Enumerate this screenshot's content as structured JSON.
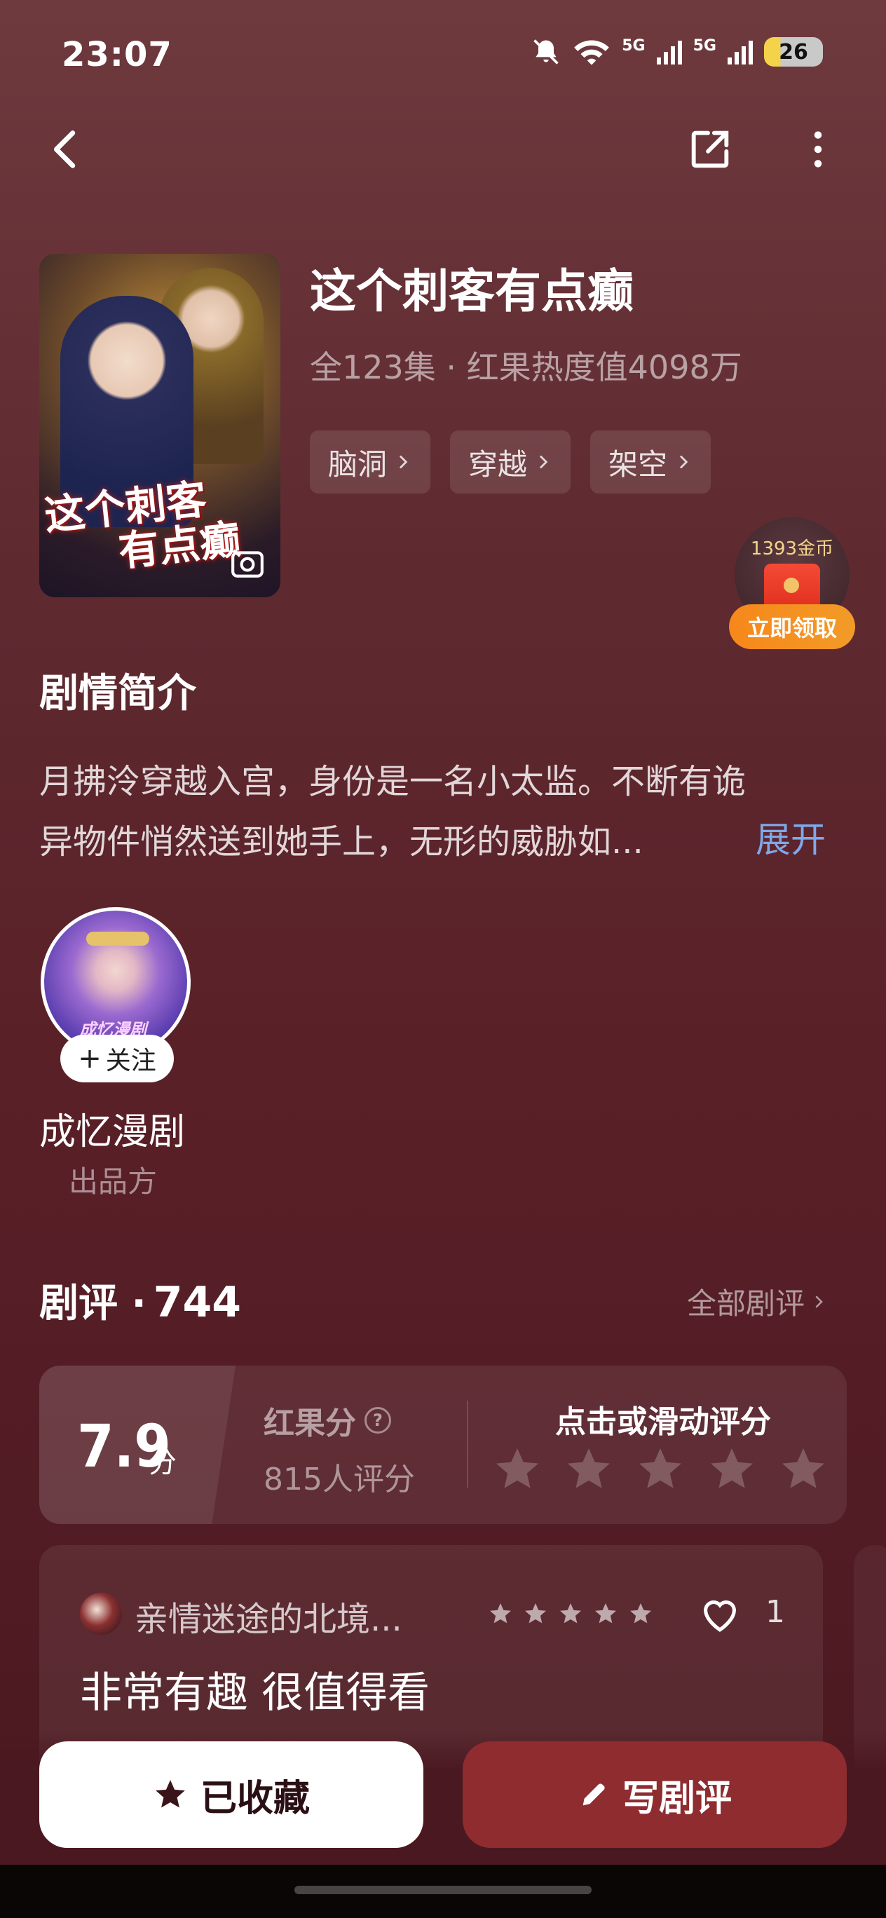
{
  "status_bar": {
    "time": "23:07",
    "network_a": "5G",
    "network_b": "5G",
    "battery": "26"
  },
  "drama": {
    "title": "这个刺客有点癫",
    "meta": "全123集 · 红果热度值4098万",
    "cover_text_line1": "这个刺客",
    "cover_text_line2": "有点癫",
    "tags": [
      "脑洞",
      "穿越",
      "架空"
    ]
  },
  "reward": {
    "coins": "1393金币",
    "claim_label": "立即领取"
  },
  "synopsis": {
    "title": "剧情简介",
    "line1": "月拂泠穿越入宫，身份是一名小太监。不断有诡",
    "line2": "异物件悄然送到她手上，无形的威胁如...",
    "expand_label": "展开"
  },
  "producer": {
    "follow_label": "关注",
    "name": "成忆漫剧",
    "role": "出品方",
    "avatar_text": "成忆漫剧"
  },
  "reviews": {
    "title": "剧评 · ",
    "count": "744",
    "all_label": "全部剧评",
    "score": "7.9",
    "score_unit": "分",
    "score_label": "红果分",
    "raters": "815人评分",
    "rate_prompt": "点击或滑动评分",
    "first": {
      "author": "亲情迷途的北境...",
      "rating_stars": 5,
      "likes": "1",
      "text": "非常有趣 很值得看"
    }
  },
  "actions": {
    "collect_label": "已收藏",
    "write_label": "写剧评"
  }
}
